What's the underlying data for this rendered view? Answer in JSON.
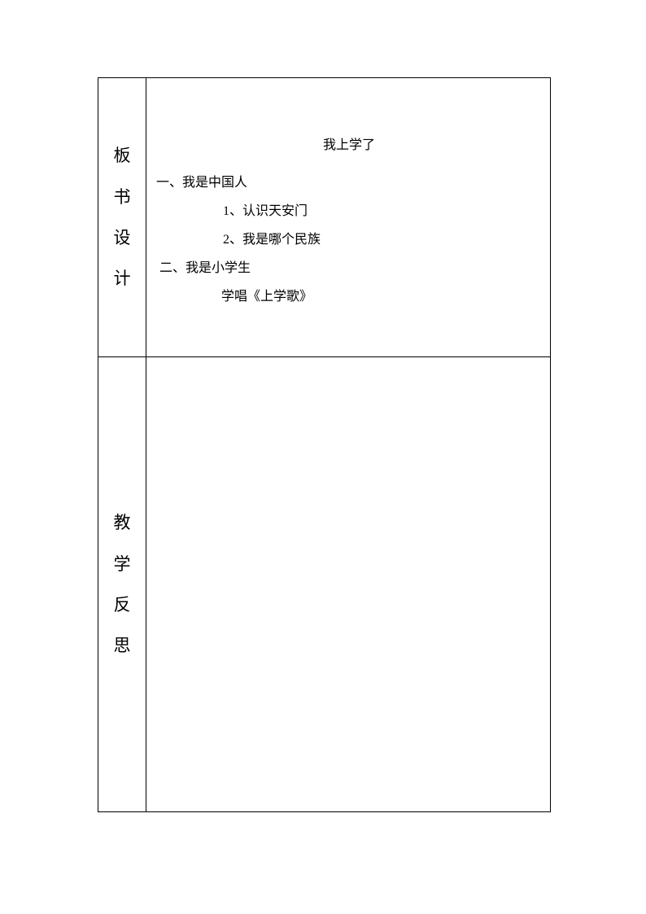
{
  "sections": {
    "board_design": {
      "label_chars": [
        "板",
        "书",
        "设",
        "计"
      ],
      "title": "我上学了",
      "items": [
        {
          "text": "一、我是中国人",
          "cls": "h1-line"
        },
        {
          "text": "1、认识天安门",
          "cls": "sub-line"
        },
        {
          "text": "2、我是哪个民族",
          "cls": "sub-line"
        },
        {
          "text": "二、我是小学生",
          "cls": "h2-line"
        },
        {
          "text": "学唱《上学歌》",
          "cls": "sub2-line"
        }
      ]
    },
    "reflection": {
      "label_chars": [
        "教",
        "学",
        "反",
        "思"
      ],
      "content": ""
    }
  }
}
